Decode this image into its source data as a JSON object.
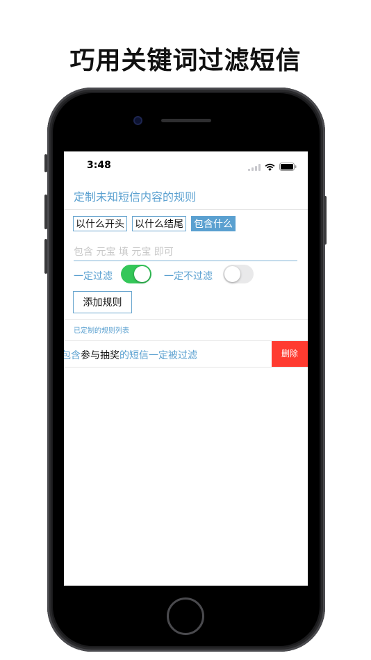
{
  "headline": "巧用关键词过滤短信",
  "status": {
    "time": "3:48"
  },
  "nav": {
    "title": "定制未知短信内容的规则"
  },
  "tags": [
    {
      "label": "以什么开头"
    },
    {
      "label": "以什么结尾"
    },
    {
      "label": "包含什么",
      "selected": true
    }
  ],
  "input": {
    "value": "",
    "placeholder": "包含 元宝 填 元宝 即可"
  },
  "switches": {
    "filter": {
      "label": "一定过滤",
      "on": true
    },
    "no_filter": {
      "label": "一定不过滤",
      "on": false
    }
  },
  "add_button": "添加规则",
  "list_section_label": "已定制的规则列表",
  "rules": [
    {
      "prefix": "包含",
      "keyword": "参与抽奖",
      "suffix": "的短信一定被过滤",
      "delete_label": "删除"
    }
  ],
  "colors": {
    "accent": "#5aa0d0",
    "switch_on": "#34c759",
    "delete": "#ff3b30"
  }
}
